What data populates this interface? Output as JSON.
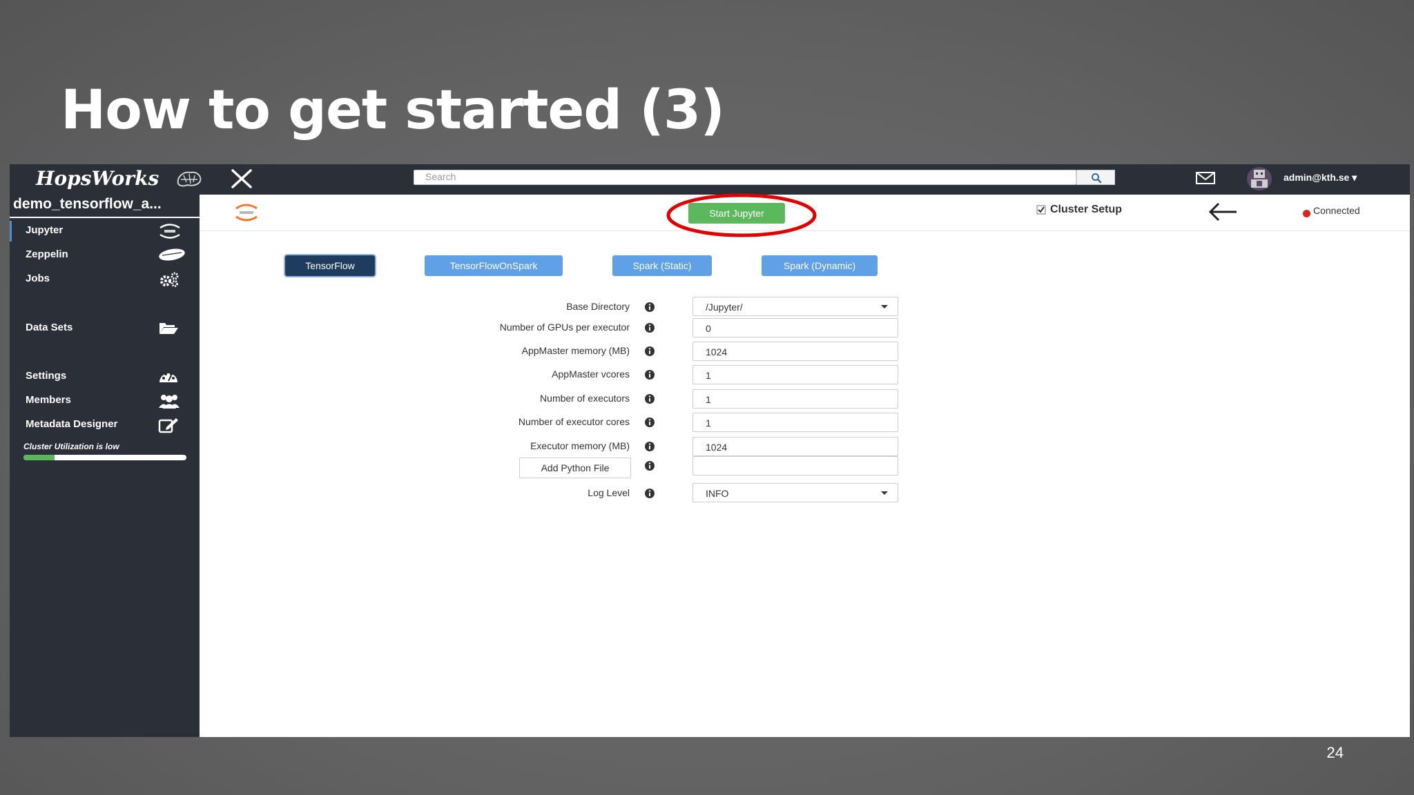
{
  "slide": {
    "title": "How to get started (3)",
    "page_number": "24"
  },
  "topbar": {
    "logo": "HopsWorks",
    "search_placeholder": "Search",
    "user": "admin@kth.se ▾"
  },
  "sidebar": {
    "project_name": "demo_tensorflow_a...",
    "items": [
      {
        "label": "Jupyter",
        "icon": "jupyter-icon"
      },
      {
        "label": "Zeppelin",
        "icon": "zeppelin-icon"
      },
      {
        "label": "Jobs",
        "icon": "gears-icon"
      },
      {
        "label": "Data Sets",
        "icon": "folder-open-icon"
      },
      {
        "label": "Settings",
        "icon": "dashboard-icon"
      },
      {
        "label": "Members",
        "icon": "users-icon"
      },
      {
        "label": "Metadata Designer",
        "icon": "edit-icon"
      }
    ],
    "utilization_label": "Cluster Utilization is low",
    "utilization_fraction": 0.19
  },
  "content": {
    "start_button": "Start Jupyter",
    "cluster_setup_label": "Cluster Setup",
    "cluster_setup_checked": true,
    "status": "Connected",
    "status_color": "#d9241c",
    "highlight_color": "#e00000",
    "tabs": [
      {
        "label": "TensorFlow",
        "selected": true
      },
      {
        "label": "TensorFlowOnSpark",
        "selected": false
      },
      {
        "label": "Spark (Static)",
        "selected": false
      },
      {
        "label": "Spark (Dynamic)",
        "selected": false
      }
    ],
    "fields": [
      {
        "label": "Base Directory",
        "value": "/Jupyter/",
        "type": "select"
      },
      {
        "label": "Number of GPUs per executor",
        "value": "0",
        "type": "input"
      },
      {
        "label": "AppMaster memory (MB)",
        "value": "1024",
        "type": "input"
      },
      {
        "label": "AppMaster vcores",
        "value": "1",
        "type": "input"
      },
      {
        "label": "Number of executors",
        "value": "1",
        "type": "input"
      },
      {
        "label": "Number of executor cores",
        "value": "1",
        "type": "input"
      },
      {
        "label": "Executor memory (MB)",
        "value": "1024",
        "type": "input"
      }
    ],
    "add_python_file_button": "Add Python File",
    "python_file_value": "",
    "log_level_label": "Log Level",
    "log_level_value": "INFO"
  }
}
